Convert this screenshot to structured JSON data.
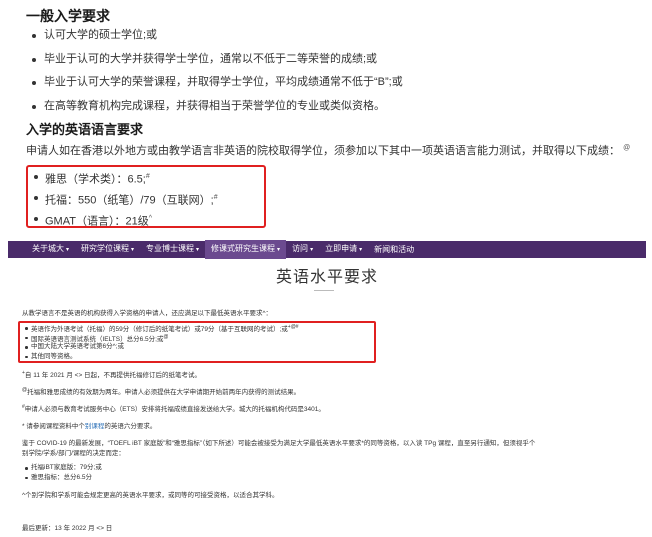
{
  "top": {
    "general_heading": "一般入学要求",
    "general_items": [
      "认可大学的硕士学位;或",
      "毕业于认可的大学并获得学士学位，通常以不低于二等荣誉的成绩;或",
      "毕业于认可大学的荣誉课程，并取得学士学位，平均成绩通常不低于“B”;或",
      "在高等教育机构完成课程，并获得相当于荣誉学位的专业或类似资格。"
    ],
    "english_heading": "入学的英语语言要求",
    "english_intro": "申请人如在香港以外地方或由教学语言非英语的院校取得学位，须参加以下其中一项英语语言能力测试，并取得以下成绩：",
    "intro_mark": "@",
    "english_items": [
      {
        "text": "雅思（学术类）：6.5;",
        "mark": "#"
      },
      {
        "text": "托福：550（纸笔）/79（互联网）;",
        "mark": "#"
      },
      {
        "text": "GMAT（语言）：21级",
        "mark": "^"
      }
    ]
  },
  "bottom": {
    "nav": [
      {
        "label": "关于城大",
        "caret": "▾"
      },
      {
        "label": "研究学位课程",
        "caret": "▾"
      },
      {
        "label": "专业博士课程",
        "caret": "▾"
      },
      {
        "label": "修课式研究生课程",
        "caret": "▾"
      },
      {
        "label": "访问",
        "caret": "▾"
      },
      {
        "label": "立即申请",
        "caret": "▾"
      },
      {
        "label": "新闻和活动",
        "caret": ""
      }
    ],
    "page_title": "英语水平要求",
    "lead": "从教学语言不是英语的机构获得入学资格的申请人，还应满足以下最低英语水平要求^：",
    "req_items": [
      {
        "text": "英语作为外语考试（托福）的59分（修订后的纸笔考试）或79分（基于互联网的考试）;或",
        "mark": "+@#"
      },
      {
        "text": "国际英语语言测试系统（IELTS）总分6.5分;或",
        "mark": "@"
      },
      {
        "text": "中国大陆大学英语考试第6分^;或",
        "mark": ""
      },
      {
        "text": "其他同等资格。",
        "mark": ""
      }
    ],
    "note1_mark": "+",
    "note1": "自 11 年 2021 月 <> 日起，不再提供托福修订后的纸笔考试。",
    "note2_mark": "@",
    "note2": "托福和雅思成绩的有效期为两年。申请人必须提供在大学申请期开始前两年内获得的测试结果。",
    "note3_mark": "#",
    "note3": "申请人必须与教育考试服务中心（ETS）安排将托福成绩直接发送给大学。城大的托福机构代码是3401。",
    "note4_pre": "* 请参阅课程资料中个",
    "note4_link": "别课程",
    "note4_post": "的英语六分要求。",
    "covid_line1": "鉴于 COVID-19 的最新发展，“TOEFL iBT 家庭版”和“雅思指标”（如下所述）可能会被接受为满足大学最低英语水平要求*的同等资格，以入读 TPg 课程，直至另行通知，但须视乎个",
    "covid_line2": "别学院/学系/部门/课程的决定而定：",
    "covid_items": [
      "托福iBT家庭版：79分;或",
      "雅思指标：总分6.5分"
    ],
    "caret_note": "^个别学院和学系可能会规定更高的英语水平要求，或同等的可接受资格，以适合其学科。",
    "updated": "最后更新：13 年 2022 月 <> 日"
  }
}
